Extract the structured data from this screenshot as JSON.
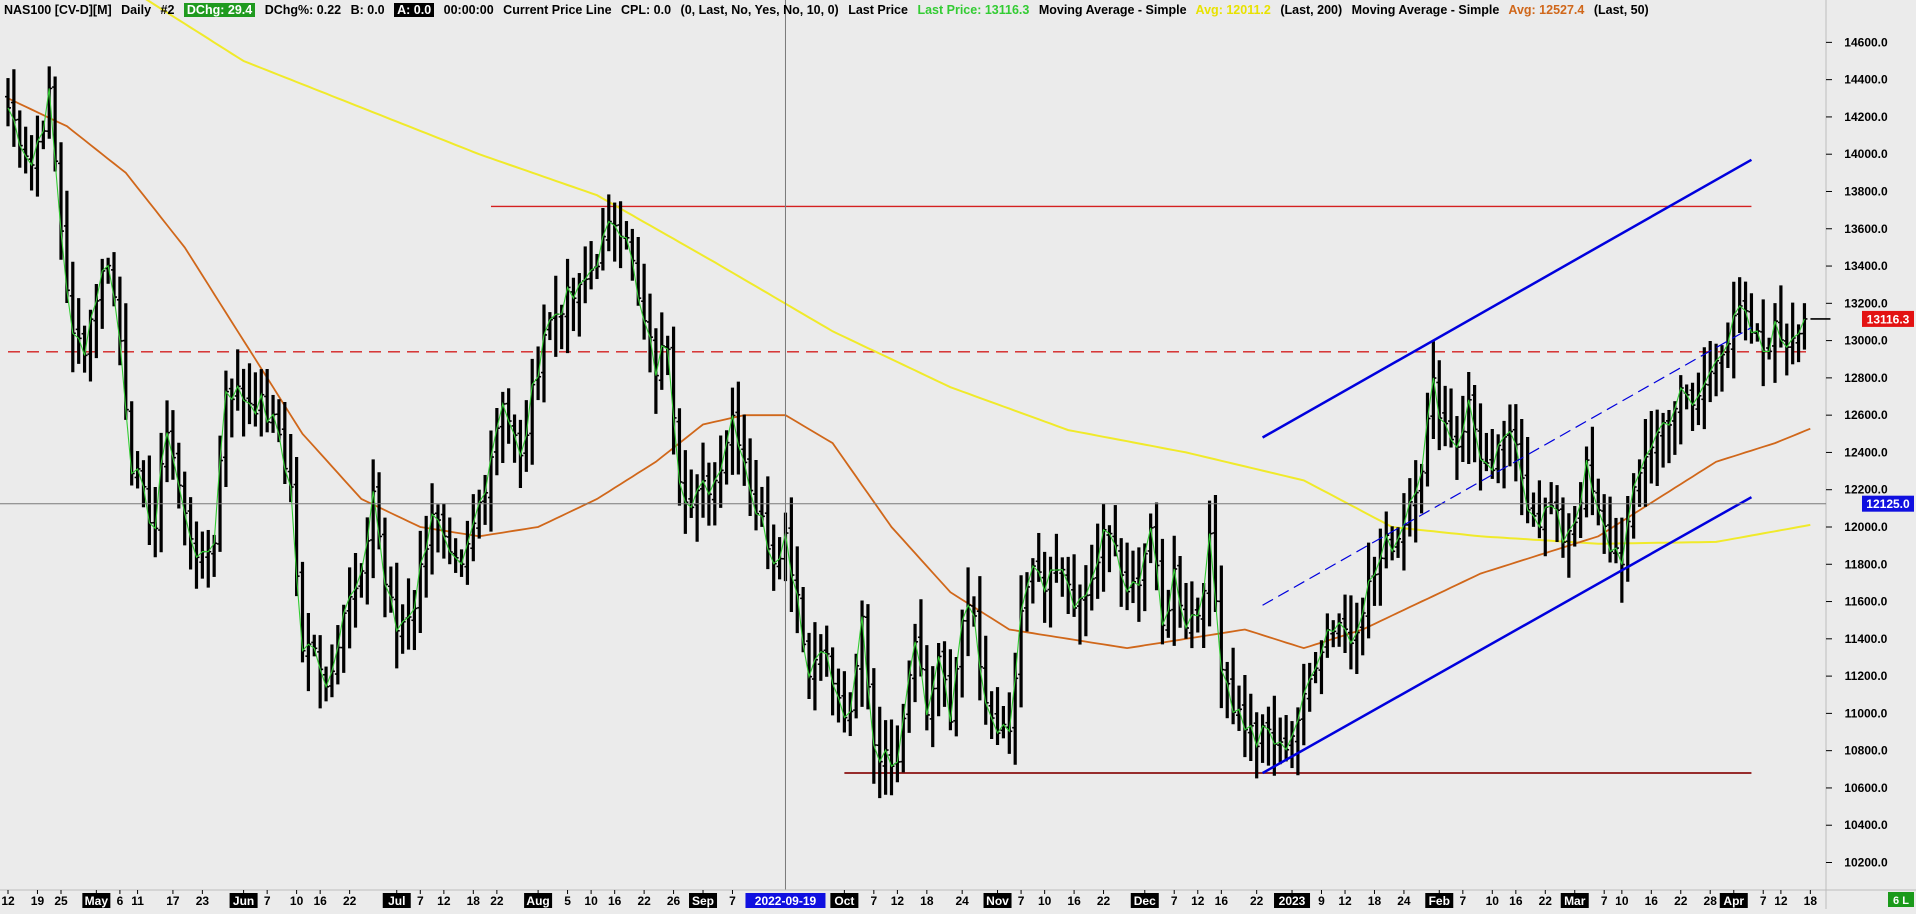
{
  "header": {
    "symbol": "NAS100 [CV-D][M]",
    "timeframe": "Daily",
    "chart_no": "#2",
    "dchg": "DChg: 29.4",
    "dchg_pct": "DChg%: 0.22",
    "bid": "B: 0.0",
    "ask": "A: 0.0",
    "time": "00:00:00",
    "study1_name": "Current Price Line",
    "study1_value": "CPL: 0.0",
    "study1_params": "(0, Last, No, Yes, No, 10, 0)",
    "study2_name": "Last Price",
    "study2_value": "Last Price: 13116.3",
    "study3_name": "Moving Average - Simple",
    "study3_value": "Avg: 12011.2",
    "study3_params": "(Last, 200)",
    "study4_name": "Moving Average - Simple",
    "study4_value": "Avg: 12527.4",
    "study4_params": "(Last, 50)"
  },
  "colors": {
    "background": "#ebebeb",
    "bar": "#000000",
    "close_line": "#33cc33",
    "ma200": "#f0ea2a",
    "ma50": "#d0671a",
    "channel": "#0000dd",
    "resistance": "#d42020",
    "support": "#8b1010",
    "last_price_tag": "#e31212",
    "crosshair_tag": "#1010e0",
    "date_tag": "#1010e0"
  },
  "price_tags": {
    "last_price": "13116.3",
    "crosshair": "12125.0",
    "corner": "6 L"
  },
  "crosshair_date": "2022-09-19",
  "chart_data": {
    "type": "ohlc",
    "y_ticks": [
      10200,
      10400,
      10600,
      10800,
      11000,
      11200,
      11400,
      11600,
      11800,
      12000,
      12200,
      12400,
      12600,
      12800,
      13000,
      13200,
      13400,
      13600,
      13800,
      14000,
      14200,
      14400,
      14600
    ],
    "y_tick_labels": [
      "10200.0",
      "10400.0",
      "10600.0",
      "10800.0",
      "11000.0",
      "11200.0",
      "11400.0",
      "11600.0",
      "11800.0",
      "12000.0",
      "12200.0",
      "12400.0",
      "12600.0",
      "12800.0",
      "13000.0",
      "13200.0",
      "13400.0",
      "13600.0",
      "13800.0",
      "14000.0",
      "14200.0",
      "14400.0",
      "14600.0"
    ],
    "ylim": [
      10090,
      14720
    ],
    "x_labels": [
      {
        "i": 0,
        "t": "12"
      },
      {
        "i": 5,
        "t": "19"
      },
      {
        "i": 9,
        "t": "25"
      },
      {
        "i": 15,
        "t": "May",
        "hl": true
      },
      {
        "i": 19,
        "t": "6"
      },
      {
        "i": 22,
        "t": "11"
      },
      {
        "i": 28,
        "t": "17"
      },
      {
        "i": 33,
        "t": "23"
      },
      {
        "i": 40,
        "t": "Jun",
        "hl": true
      },
      {
        "i": 44,
        "t": "7"
      },
      {
        "i": 49,
        "t": "10"
      },
      {
        "i": 53,
        "t": "16"
      },
      {
        "i": 58,
        "t": "22"
      },
      {
        "i": 66,
        "t": "Jul",
        "hl": true
      },
      {
        "i": 70,
        "t": "7"
      },
      {
        "i": 74,
        "t": "12"
      },
      {
        "i": 79,
        "t": "18"
      },
      {
        "i": 83,
        "t": "22"
      },
      {
        "i": 90,
        "t": "Aug",
        "hl": true
      },
      {
        "i": 95,
        "t": "5"
      },
      {
        "i": 99,
        "t": "10"
      },
      {
        "i": 103,
        "t": "16"
      },
      {
        "i": 108,
        "t": "22"
      },
      {
        "i": 113,
        "t": "26"
      },
      {
        "i": 118,
        "t": "Sep",
        "hl": true
      },
      {
        "i": 123,
        "t": "7"
      },
      {
        "i": 142,
        "t": "Oct",
        "hl": true
      },
      {
        "i": 147,
        "t": "7"
      },
      {
        "i": 151,
        "t": "12"
      },
      {
        "i": 156,
        "t": "18"
      },
      {
        "i": 162,
        "t": "24"
      },
      {
        "i": 168,
        "t": "Nov",
        "hl": true
      },
      {
        "i": 172,
        "t": "7"
      },
      {
        "i": 176,
        "t": "10"
      },
      {
        "i": 181,
        "t": "16"
      },
      {
        "i": 186,
        "t": "22"
      },
      {
        "i": 193,
        "t": "Dec",
        "hl": true
      },
      {
        "i": 198,
        "t": "7"
      },
      {
        "i": 202,
        "t": "12"
      },
      {
        "i": 206,
        "t": "16"
      },
      {
        "i": 212,
        "t": "22"
      },
      {
        "i": 218,
        "t": "2023",
        "hl": true
      },
      {
        "i": 223,
        "t": "9"
      },
      {
        "i": 227,
        "t": "12"
      },
      {
        "i": 232,
        "t": "18"
      },
      {
        "i": 237,
        "t": "24"
      },
      {
        "i": 243,
        "t": "Feb",
        "hl": true
      },
      {
        "i": 247,
        "t": "7"
      },
      {
        "i": 252,
        "t": "10"
      },
      {
        "i": 256,
        "t": "16"
      },
      {
        "i": 261,
        "t": "22"
      },
      {
        "i": 266,
        "t": "Mar",
        "hl": true
      },
      {
        "i": 271,
        "t": "7"
      },
      {
        "i": 274,
        "t": "10"
      },
      {
        "i": 279,
        "t": "16"
      },
      {
        "i": 284,
        "t": "22"
      },
      {
        "i": 289,
        "t": "28"
      },
      {
        "i": 293,
        "t": "Apr",
        "hl": true
      },
      {
        "i": 298,
        "t": "7"
      },
      {
        "i": 301,
        "t": "12"
      },
      {
        "i": 306,
        "t": "18"
      }
    ],
    "crosshair_bar": 132,
    "crosshair_price": 12125.0,
    "closes_anchors": [
      [
        0,
        14250
      ],
      [
        4,
        13950
      ],
      [
        7,
        14300
      ],
      [
        9,
        13600
      ],
      [
        11,
        13000
      ],
      [
        13,
        12980
      ],
      [
        15,
        13250
      ],
      [
        17,
        13450
      ],
      [
        19,
        13000
      ],
      [
        21,
        12350
      ],
      [
        23,
        12150
      ],
      [
        25,
        12000
      ],
      [
        27,
        12550
      ],
      [
        30,
        12050
      ],
      [
        33,
        11800
      ],
      [
        35,
        11950
      ],
      [
        37,
        12750
      ],
      [
        40,
        12700
      ],
      [
        43,
        12650
      ],
      [
        46,
        12500
      ],
      [
        48,
        12200
      ],
      [
        50,
        11300
      ],
      [
        52,
        11400
      ],
      [
        54,
        11150
      ],
      [
        57,
        11550
      ],
      [
        60,
        11700
      ],
      [
        62,
        12200
      ],
      [
        64,
        11700
      ],
      [
        66,
        11450
      ],
      [
        69,
        11600
      ],
      [
        72,
        12100
      ],
      [
        75,
        11800
      ],
      [
        77,
        11750
      ],
      [
        79,
        12000
      ],
      [
        81,
        12250
      ],
      [
        84,
        12700
      ],
      [
        87,
        12350
      ],
      [
        89,
        12700
      ],
      [
        91,
        13050
      ],
      [
        94,
        13200
      ],
      [
        97,
        13250
      ],
      [
        100,
        13450
      ],
      [
        103,
        13650
      ],
      [
        105,
        13600
      ],
      [
        107,
        13200
      ],
      [
        110,
        12850
      ],
      [
        112,
        13000
      ],
      [
        114,
        12300
      ],
      [
        116,
        12100
      ],
      [
        118,
        12200
      ],
      [
        120,
        12250
      ],
      [
        123,
        12600
      ],
      [
        124,
        12500
      ],
      [
        127,
        12100
      ],
      [
        130,
        11850
      ],
      [
        132,
        11950
      ],
      [
        134,
        11650
      ],
      [
        136,
        11200
      ],
      [
        138,
        11400
      ],
      [
        141,
        11050
      ],
      [
        143,
        10950
      ],
      [
        145,
        11500
      ],
      [
        147,
        10850
      ],
      [
        149,
        10750
      ],
      [
        151,
        10800
      ],
      [
        154,
        11450
      ],
      [
        156,
        11000
      ],
      [
        158,
        11300
      ],
      [
        160,
        10950
      ],
      [
        162,
        11550
      ],
      [
        164,
        11500
      ],
      [
        166,
        11000
      ],
      [
        168,
        10900
      ],
      [
        170,
        10850
      ],
      [
        172,
        11550
      ],
      [
        174,
        11750
      ],
      [
        176,
        11650
      ],
      [
        178,
        11750
      ],
      [
        180,
        11700
      ],
      [
        182,
        11550
      ],
      [
        184,
        11700
      ],
      [
        186,
        11950
      ],
      [
        188,
        11900
      ],
      [
        190,
        11600
      ],
      [
        192,
        11750
      ],
      [
        194,
        12000
      ],
      [
        196,
        11450
      ],
      [
        198,
        11750
      ],
      [
        200,
        11500
      ],
      [
        202,
        11550
      ],
      [
        204,
        11900
      ],
      [
        206,
        11300
      ],
      [
        208,
        11050
      ],
      [
        210,
        10950
      ],
      [
        212,
        10850
      ],
      [
        214,
        10900
      ],
      [
        216,
        10800
      ],
      [
        218,
        10900
      ],
      [
        220,
        11050
      ],
      [
        222,
        11300
      ],
      [
        224,
        11450
      ],
      [
        226,
        11500
      ],
      [
        228,
        11400
      ],
      [
        230,
        11600
      ],
      [
        232,
        11750
      ],
      [
        234,
        11900
      ],
      [
        236,
        11950
      ],
      [
        238,
        12150
      ],
      [
        240,
        12350
      ],
      [
        242,
        12750
      ],
      [
        244,
        12550
      ],
      [
        246,
        12450
      ],
      [
        248,
        12650
      ],
      [
        250,
        12400
      ],
      [
        252,
        12250
      ],
      [
        254,
        12500
      ],
      [
        256,
        12400
      ],
      [
        258,
        12150
      ],
      [
        260,
        12050
      ],
      [
        262,
        12100
      ],
      [
        264,
        11950
      ],
      [
        266,
        12050
      ],
      [
        268,
        12300
      ],
      [
        270,
        12050
      ],
      [
        272,
        11900
      ],
      [
        274,
        11850
      ],
      [
        276,
        12150
      ],
      [
        278,
        12400
      ],
      [
        280,
        12500
      ],
      [
        282,
        12600
      ],
      [
        284,
        12700
      ],
      [
        286,
        12650
      ],
      [
        288,
        12750
      ],
      [
        290,
        12950
      ],
      [
        292,
        13000
      ],
      [
        294,
        13150
      ],
      [
        296,
        13050
      ],
      [
        298,
        12950
      ],
      [
        300,
        13050
      ],
      [
        302,
        13000
      ],
      [
        304,
        13100
      ],
      [
        305,
        13116.3
      ]
    ],
    "ma200_anchors": [
      [
        0,
        15200
      ],
      [
        20,
        14900
      ],
      [
        40,
        14500
      ],
      [
        60,
        14250
      ],
      [
        80,
        14000
      ],
      [
        100,
        13780
      ],
      [
        120,
        13420
      ],
      [
        140,
        13050
      ],
      [
        160,
        12750
      ],
      [
        180,
        12520
      ],
      [
        200,
        12400
      ],
      [
        220,
        12250
      ],
      [
        235,
        12000
      ],
      [
        250,
        11950
      ],
      [
        270,
        11910
      ],
      [
        290,
        11920
      ],
      [
        306,
        12011.2
      ]
    ],
    "ma50_anchors": [
      [
        0,
        14300
      ],
      [
        10,
        14150
      ],
      [
        20,
        13900
      ],
      [
        30,
        13500
      ],
      [
        40,
        13000
      ],
      [
        50,
        12500
      ],
      [
        60,
        12150
      ],
      [
        70,
        12000
      ],
      [
        80,
        11950
      ],
      [
        90,
        12000
      ],
      [
        100,
        12150
      ],
      [
        110,
        12350
      ],
      [
        118,
        12550
      ],
      [
        125,
        12600
      ],
      [
        132,
        12600
      ],
      [
        140,
        12450
      ],
      [
        150,
        12000
      ],
      [
        160,
        11650
      ],
      [
        170,
        11450
      ],
      [
        180,
        11400
      ],
      [
        190,
        11350
      ],
      [
        200,
        11400
      ],
      [
        210,
        11450
      ],
      [
        220,
        11350
      ],
      [
        230,
        11450
      ],
      [
        240,
        11600
      ],
      [
        250,
        11750
      ],
      [
        260,
        11850
      ],
      [
        270,
        11950
      ],
      [
        280,
        12150
      ],
      [
        290,
        12350
      ],
      [
        300,
        12450
      ],
      [
        306,
        12527.4
      ]
    ],
    "resistance_levels": [
      {
        "price": 13720,
        "from": 82,
        "to": 296,
        "style": "solid"
      },
      {
        "price": 12940,
        "from": 0,
        "to": 306,
        "style": "dashed"
      },
      {
        "price": 10680,
        "from": 142,
        "to": 296,
        "style": "solid"
      }
    ],
    "channel_lines": [
      {
        "from": [
          213,
          12480
        ],
        "to": [
          296,
          13970
        ],
        "style": "solid",
        "width": 2.5
      },
      {
        "from": [
          213,
          10680
        ],
        "to": [
          296,
          12160
        ],
        "style": "solid",
        "width": 2.5
      },
      {
        "from": [
          213,
          11580
        ],
        "to": [
          296,
          13070
        ],
        "style": "dashed",
        "width": 1.2
      }
    ]
  }
}
